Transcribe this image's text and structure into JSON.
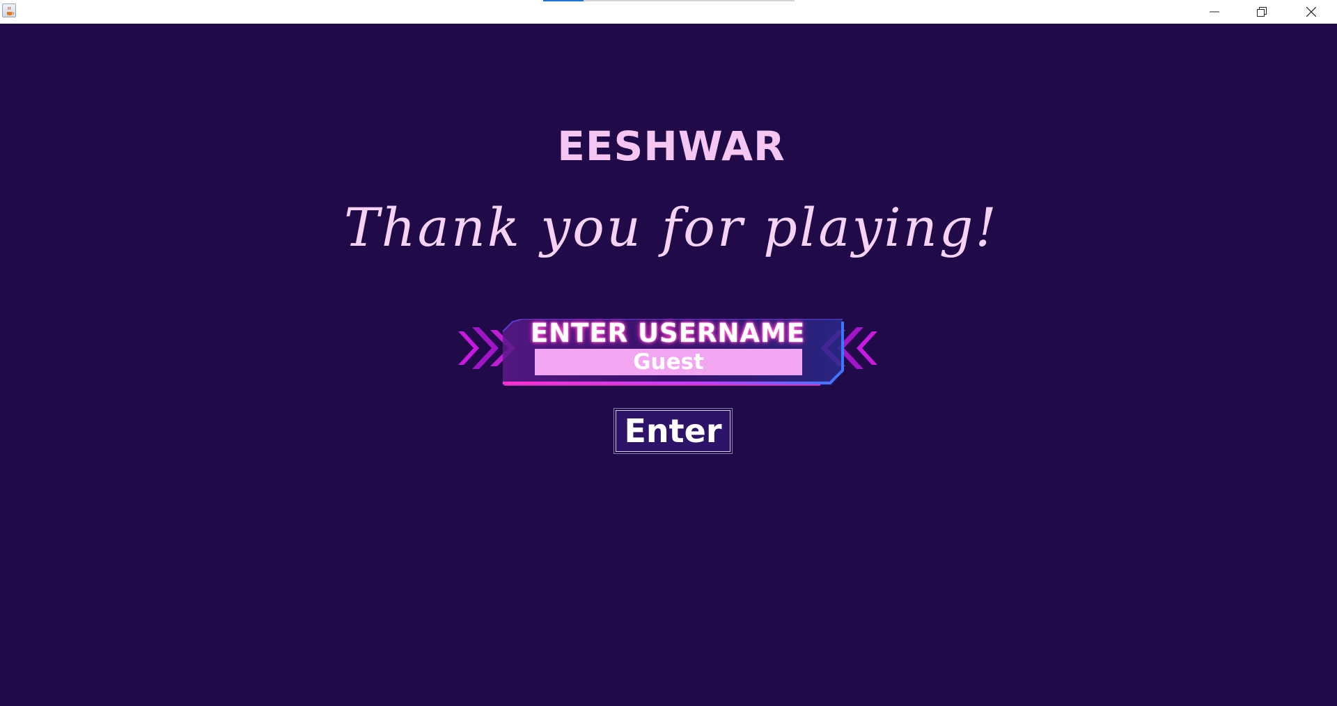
{
  "window": {
    "icons": {
      "app": "java-coffee-icon",
      "minimize": "minimize-icon",
      "restore": "restore-icon",
      "close": "close-icon"
    },
    "loading_progress": 0.16
  },
  "game": {
    "player_name": "EESHWAR",
    "message": "Thank you for playing!",
    "username_banner_label": "ENTER USERNAME",
    "username_value": "Guest",
    "enter_button_label": "Enter"
  },
  "colors": {
    "background": "#200a48",
    "name_text": "#f6c6f2",
    "message_text": "#f6d2f4",
    "input_fill": "#f2a6f2",
    "button_fill": "#2e1468",
    "neon_pink": "#ff2fc4",
    "neon_blue": "#3a78ff"
  }
}
